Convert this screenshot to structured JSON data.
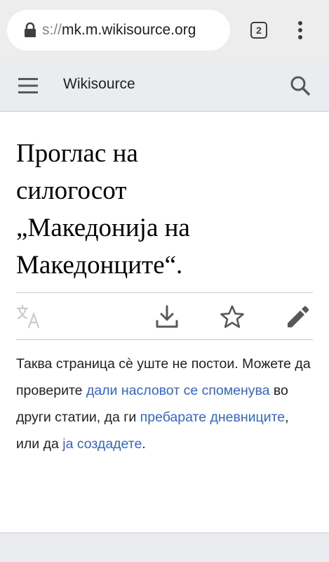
{
  "browser": {
    "url_scheme": "s://",
    "url_host": "mk.m.wikisource.org",
    "tab_count": "2"
  },
  "header": {
    "site_name": "Wikisource"
  },
  "page": {
    "title_lines": [
      "Проглас на",
      "силогосот",
      "„Македонија на",
      "Македонците“."
    ]
  },
  "content": {
    "p1": "Таква страница сѐ уште не постои. Можете да проверите ",
    "link1": "дали насловот се споменува",
    "p2": " во други статии, да ги ",
    "link2": "пребарате дневниците",
    "p3": ", или да ",
    "link3": "ја создадете",
    "p4": "."
  }
}
